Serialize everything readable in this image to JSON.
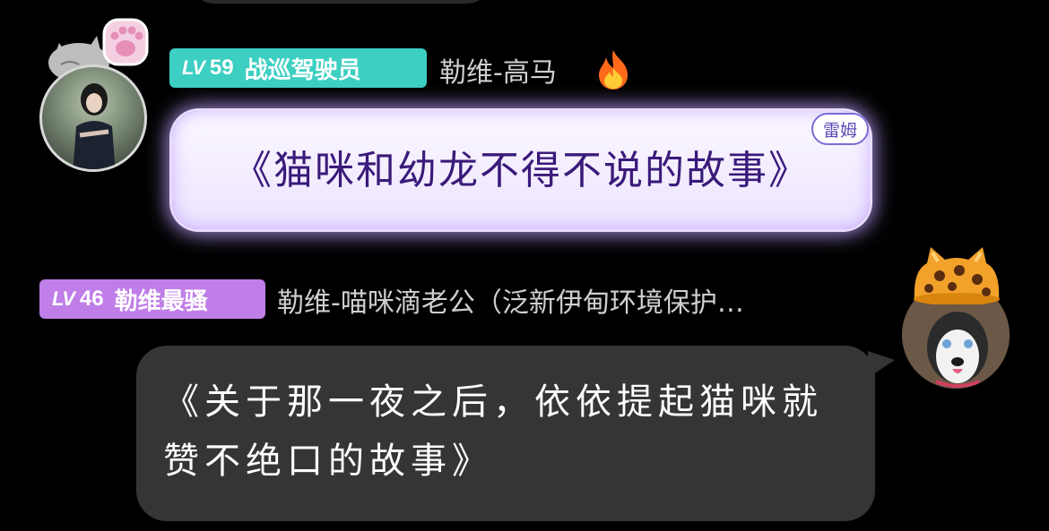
{
  "message1": {
    "badge": {
      "lv": "LV",
      "level": "59",
      "title": "战巡驾驶员",
      "color": "#3ccfc2"
    },
    "username": "勒维-高马",
    "bubble_text": "《猫咪和幼龙不得不说的故事》",
    "tag": "雷姆",
    "icons": [
      "cat-paw-icon",
      "fire-icon"
    ]
  },
  "message2": {
    "badge": {
      "lv": "LV",
      "level": "46",
      "title": "勒维最骚",
      "color": "#c07ee8"
    },
    "username": "勒维-喵咪滴老公（泛新伊甸环境保护…",
    "bubble_text": "《关于那一夜之后，依依提起猫咪就赞不绝口的故事》",
    "icons": [
      "leopard-hat-icon"
    ]
  }
}
